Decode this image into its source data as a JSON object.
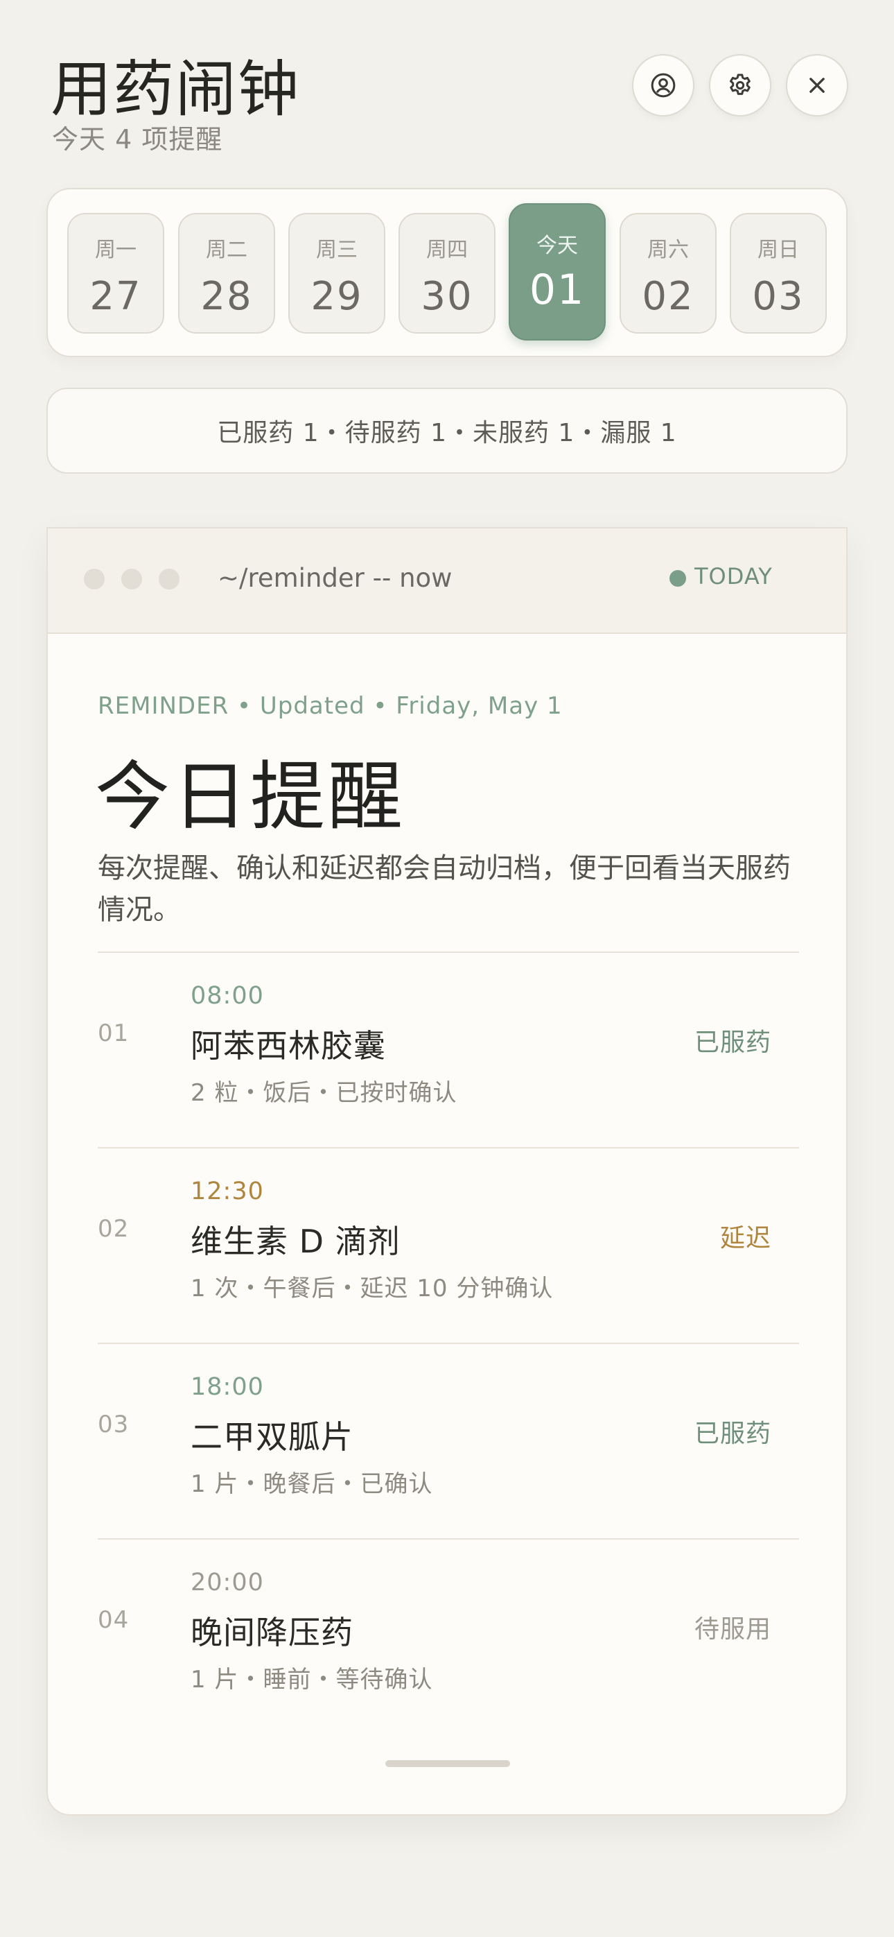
{
  "header": {
    "title": "用药闹钟",
    "subtitle": "今天 4 项提醒",
    "buttons": [
      {
        "icon": "user-circle-icon"
      },
      {
        "icon": "gear-icon"
      },
      {
        "icon": "close-icon"
      }
    ]
  },
  "week": [
    {
      "dow": "周一",
      "date": "27",
      "today": false
    },
    {
      "dow": "周二",
      "date": "28",
      "today": false
    },
    {
      "dow": "周三",
      "date": "29",
      "today": false
    },
    {
      "dow": "周四",
      "date": "30",
      "today": false
    },
    {
      "dow": "今天",
      "date": "01",
      "today": true
    },
    {
      "dow": "周六",
      "date": "02",
      "today": false
    },
    {
      "dow": "周日",
      "date": "03",
      "today": false
    }
  ],
  "summary": "已服药 1・待服药 1・未服药 1・漏服 1",
  "card": {
    "path": "~/reminder -- now",
    "live_label": "TODAY",
    "meta": "REMINDER • Updated • Friday, May 1",
    "title": "今日提醒",
    "description": "每次提醒、确认和延迟都会自动归档，便于回看当天服药情况。",
    "items": [
      {
        "index": "01",
        "time": "08:00",
        "name": "阿苯西林胶囊",
        "detail": "2 粒・饭后・已按时确认",
        "status": "已服药",
        "state": "taken"
      },
      {
        "index": "02",
        "time": "12:30",
        "name": "维生素 D 滴剂",
        "detail": "1 次・午餐后・延迟 10 分钟确认",
        "status": "延迟",
        "state": "delayed"
      },
      {
        "index": "03",
        "time": "18:00",
        "name": "二甲双胍片",
        "detail": "1 片・晚餐后・已确认",
        "status": "已服药",
        "state": "taken"
      },
      {
        "index": "04",
        "time": "20:00",
        "name": "晚间降压药",
        "detail": "1 片・睡前・等待确认",
        "status": "待服用",
        "state": "pending"
      }
    ]
  },
  "colors": {
    "accent": "#7a9e87",
    "delayed": "#b0863f",
    "background": "#f3f1ec"
  }
}
